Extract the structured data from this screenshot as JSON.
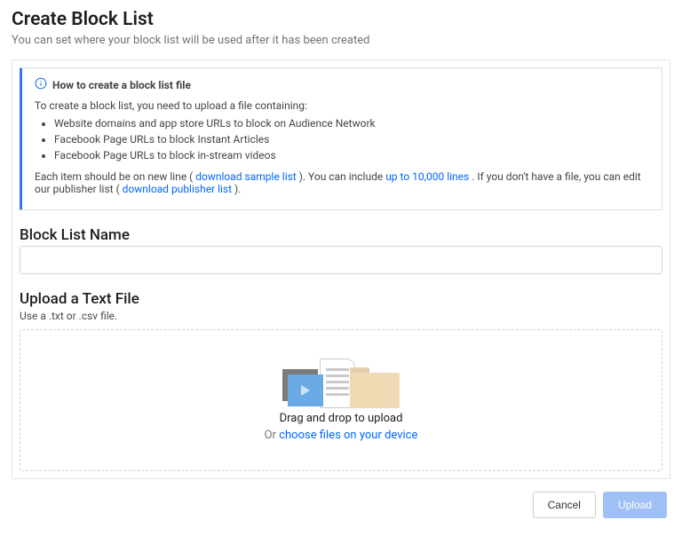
{
  "header": {
    "title": "Create Block List",
    "subtitle": "You can set where your block list will be used after it has been created"
  },
  "info": {
    "heading": "How to create a block list file",
    "intro": "To create a block list, you need to upload a file containing:",
    "bullets": [
      "Website domains and app store URLs to block on Audience Network",
      "Facebook Page URLs to block Instant Articles",
      "Facebook Page URLs to block in-stream videos"
    ],
    "footer_1": "Each item should be on new line (",
    "footer_sample_link": "download sample list",
    "footer_2": "). You can include ",
    "footer_lines_link": "up to 10,000 lines",
    "footer_3": ". If you don't have a file, you can edit our publisher list (",
    "footer_publisher_link": "download publisher list",
    "footer_4": ")."
  },
  "name_section": {
    "heading": "Block List Name",
    "value": ""
  },
  "upload_section": {
    "heading": "Upload a Text File",
    "hint": "Use a .txt or .csv file.",
    "drag_text": "Drag and drop to upload",
    "or_prefix": "Or ",
    "choose_link": "choose files on your device"
  },
  "footer": {
    "cancel": "Cancel",
    "upload": "Upload"
  }
}
